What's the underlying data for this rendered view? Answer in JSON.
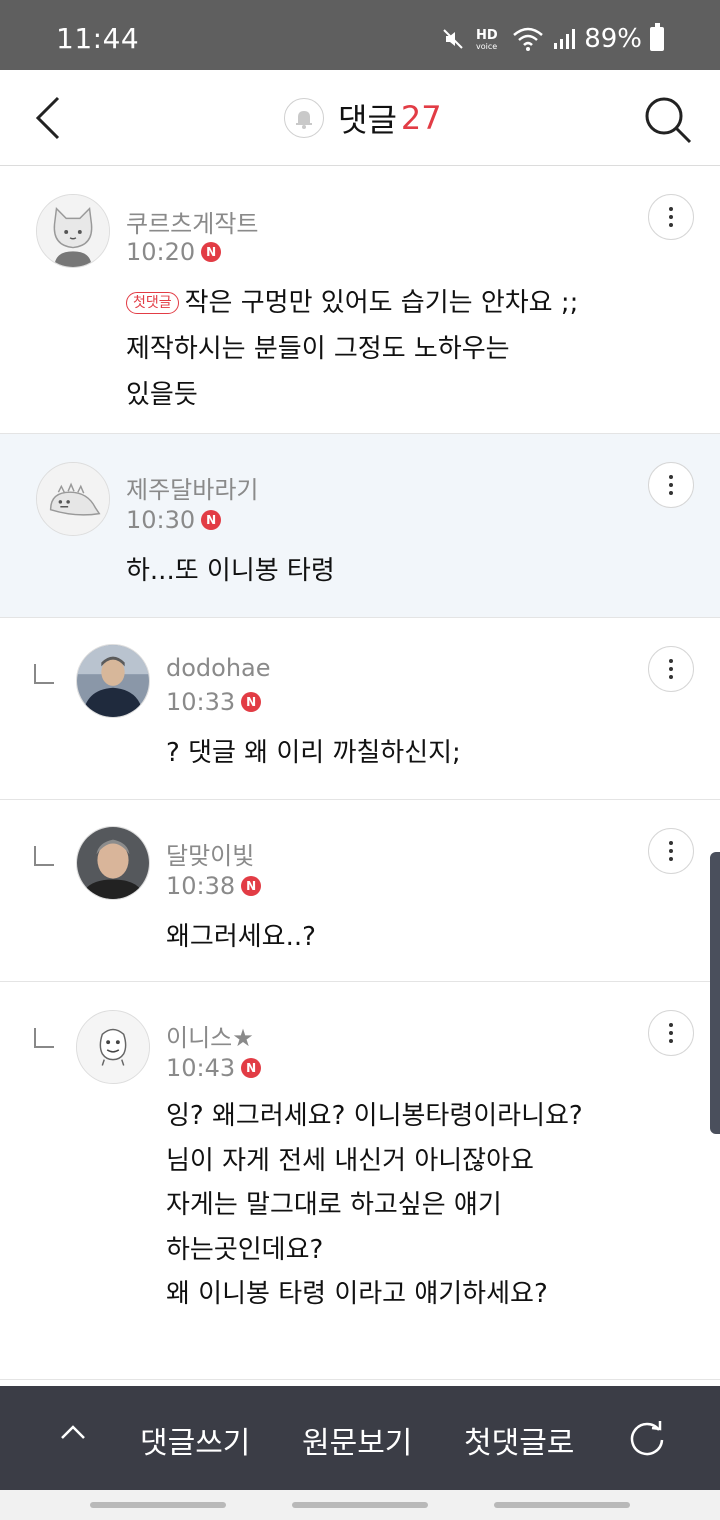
{
  "status_bar": {
    "time": "11:44",
    "battery": "89%"
  },
  "header": {
    "title": "댓글",
    "count": "27"
  },
  "comments": [
    {
      "author": "쿠르츠게작트",
      "time": "10:20",
      "new_badge": "N",
      "first_tag": "첫댓글",
      "lines": [
        "작은 구멍만 있어도 습기는 안차요 ;;",
        "제작하시는 분들이 그정도 노하우는",
        "있을듯"
      ]
    },
    {
      "author": "제주달바라기",
      "time": "10:30",
      "new_badge": "N",
      "lines": [
        "하...또 이니봉 타령"
      ]
    },
    {
      "author": "dodohae",
      "time": "10:33",
      "new_badge": "N",
      "lines": [
        "? 댓글 왜 이리 까칠하신지;"
      ]
    },
    {
      "author": "달맞이빛",
      "time": "10:38",
      "new_badge": "N",
      "lines": [
        "왜그러세요..?"
      ]
    },
    {
      "author": "이니스★",
      "time": "10:43",
      "new_badge": "N",
      "lines": [
        "잉? 왜그러세요? 이니봉타령이라니요?",
        "님이 자게 전세 내신거 아니잖아요",
        "자게는 말그대로 하고싶은 얘기",
        "하는곳인데요?",
        "왜 이니봉 타령 이라고 얘기하세요?"
      ]
    }
  ],
  "bottom_bar": {
    "write_label": "댓글쓰기",
    "original_label": "원문보기",
    "first_label": "첫댓글로"
  },
  "colors": {
    "accent": "#e23c45",
    "bottom_bar": "#3b3d46",
    "highlight_row": "#f2f6fa"
  }
}
